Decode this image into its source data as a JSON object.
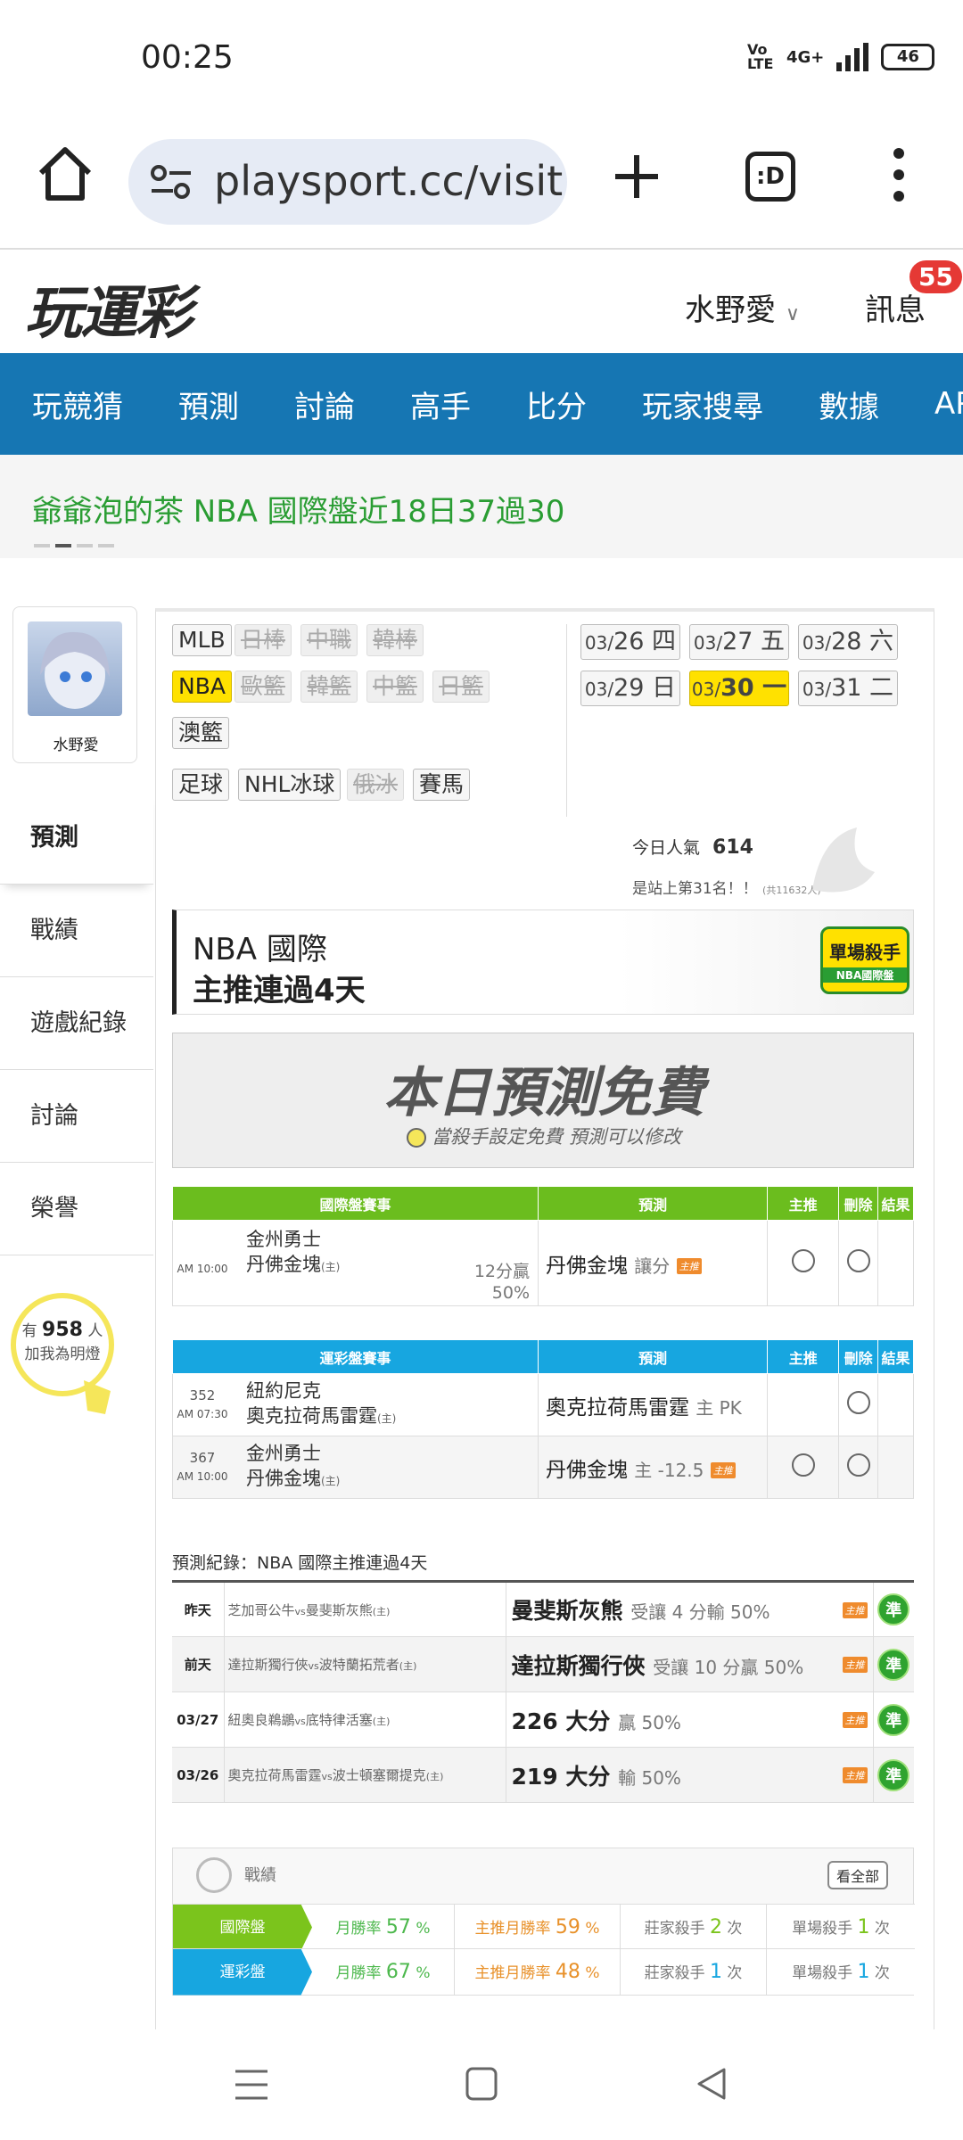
{
  "status": {
    "time": "00:25",
    "volte": "Vo LTE",
    "network": "4G+",
    "battery": "46"
  },
  "browser": {
    "url": "playsport.cc/visit",
    "tab_label": ":D"
  },
  "site": {
    "logo_main": "玩運彩",
    "user_name": "水野愛",
    "messages_label": "訊息",
    "messages_count": "55",
    "nav": [
      "玩競猜",
      "預測",
      "討論",
      "高手",
      "比分",
      "玩家搜尋",
      "數據",
      "APP"
    ],
    "marquee": "爺爺泡的茶 NBA 國際盤近18日37過30"
  },
  "sidebar": {
    "avatar_name": "水野愛",
    "menu": [
      "預測",
      "戰績",
      "遊戲紀錄",
      "討論",
      "榮譽"
    ],
    "fans_prefix": "有",
    "fans_count": "958",
    "fans_unit": "人",
    "fans_text": "加我為明燈"
  },
  "sports": {
    "row1": [
      {
        "label": "MLB",
        "state": "normal"
      },
      {
        "label": "日棒",
        "state": "off"
      },
      {
        "label": "中職",
        "state": "off"
      },
      {
        "label": "韓棒",
        "state": "off"
      }
    ],
    "row2": [
      {
        "label": "NBA",
        "state": "on"
      },
      {
        "label": "歐籃",
        "state": "off"
      },
      {
        "label": "韓籃",
        "state": "off"
      },
      {
        "label": "中籃",
        "state": "off"
      },
      {
        "label": "日籃",
        "state": "off"
      }
    ],
    "row3": [
      {
        "label": "澳籃",
        "state": "normal"
      }
    ],
    "row4": [
      {
        "label": "足球",
        "state": "normal"
      },
      {
        "label": "NHL冰球",
        "state": "normal"
      },
      {
        "label": "俄冰",
        "state": "off"
      },
      {
        "label": "賽馬",
        "state": "normal"
      }
    ]
  },
  "dates": [
    {
      "prefix": "03/",
      "day": "26 四"
    },
    {
      "prefix": "03/",
      "day": "27 五"
    },
    {
      "prefix": "03/",
      "day": "28 六"
    },
    {
      "prefix": "03/",
      "day": "29 日"
    },
    {
      "prefix": "03/",
      "day": "30 一"
    },
    {
      "prefix": "03/",
      "day": "31 二"
    }
  ],
  "popularity": {
    "label": "今日人氣",
    "value": "614",
    "rank": "是站上第31名！！",
    "rank_note": "(共11632人)"
  },
  "banner1": {
    "line1": "NBA 國際",
    "line2": "主推連過4天",
    "badge": "單場殺手",
    "badge_sub": "NBA國際盤"
  },
  "banner2": {
    "title": "本日預測免費",
    "sub": "當殺手設定免費  預測可以修改"
  },
  "intl_table": {
    "headers": [
      "國際盤賽事",
      "預測",
      "主推",
      "刪除",
      "結果"
    ],
    "rows": [
      {
        "time": "AM 10:00",
        "away": "金州勇士",
        "home": "丹佛金塊",
        "home_tag": "(主)",
        "odds1": "12分贏",
        "odds2": "50%",
        "pick": "丹佛金塊",
        "pick_note": "讓分",
        "tag": "主推"
      }
    ]
  },
  "sport_table": {
    "headers": [
      "運彩盤賽事",
      "預測",
      "主推",
      "刪除",
      "結果"
    ],
    "rows": [
      {
        "no": "352",
        "time": "AM 07:30",
        "away": "紐約尼克",
        "home": "奧克拉荷馬雷霆",
        "home_tag": "(主)",
        "pick": "奧克拉荷馬雷霆",
        "pick_note": "主 PK",
        "tag": ""
      },
      {
        "no": "367",
        "time": "AM 10:00",
        "away": "金州勇士",
        "home": "丹佛金塊",
        "home_tag": "(主)",
        "pick": "丹佛金塊",
        "pick_note": "主 -12.5",
        "tag": "主推"
      }
    ]
  },
  "record": {
    "title": "預測紀錄：NBA 國際主推連過4天",
    "rows": [
      {
        "day": "昨天",
        "away": "芝加哥公牛",
        "home": "曼斐斯灰熊",
        "pick": "曼斐斯灰熊",
        "note": "受讓 4 分輸 50%",
        "tag": "主推",
        "ok": "準"
      },
      {
        "day": "前天",
        "away": "達拉斯獨行俠",
        "home": "波特蘭拓荒者",
        "pick": "達拉斯獨行俠",
        "note": "受讓 10 分贏 50%",
        "tag": "主推",
        "ok": "準"
      },
      {
        "day": "03/27",
        "away": "紐奧良鵜鶘",
        "home": "底特律活塞",
        "pick": "226 大分",
        "note": "贏 50%",
        "tag": "主推",
        "ok": "準"
      },
      {
        "day": "03/26",
        "away": "奧克拉荷馬雷霆",
        "home": "波士頓塞爾提克",
        "pick": "219 大分",
        "note": "輸 50%",
        "tag": "主推",
        "ok": "準"
      }
    ],
    "vs": "vs",
    "home_tag": "(主)"
  },
  "performance": {
    "title": "戰績",
    "view_all": "看全部",
    "rows": [
      {
        "label": "國際盤",
        "color": "#7bc41c",
        "win_label": "月勝率",
        "win": "57",
        "main_label": "主推月勝率",
        "main": "59",
        "dealer_label": "莊家殺手",
        "dealer": "2",
        "single_label": "單場殺手",
        "single": "1",
        "unit_pct": "%",
        "unit_times": "次"
      },
      {
        "label": "運彩盤",
        "color": "#17a6e0",
        "win_label": "月勝率",
        "win": "67",
        "main_label": "主推月勝率",
        "main": "48",
        "dealer_label": "莊家殺手",
        "dealer": "1",
        "single_label": "單場殺手",
        "single": "1",
        "unit_pct": "%",
        "unit_times": "次"
      }
    ]
  }
}
